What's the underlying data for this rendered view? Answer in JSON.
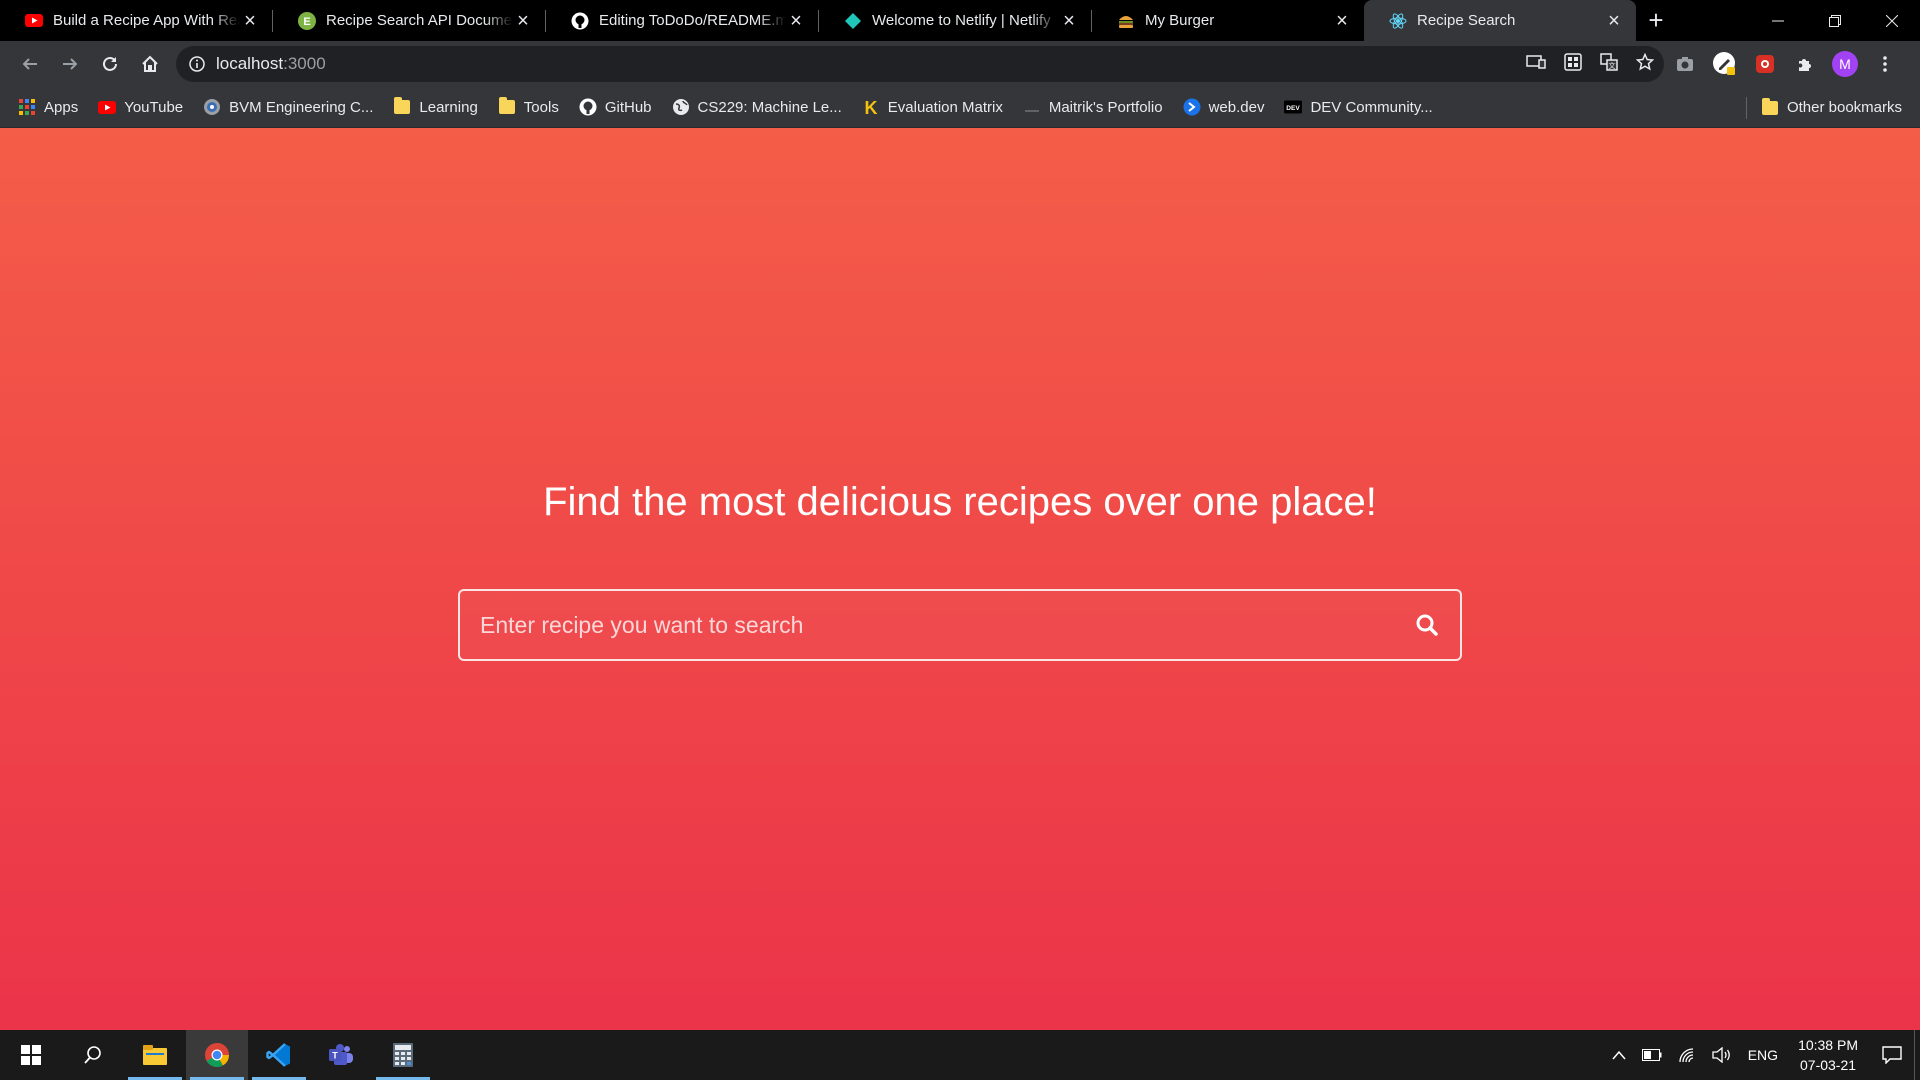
{
  "browser": {
    "tabs": [
      {
        "title": "Build a Recipe App With Reac",
        "favicon": "youtube-icon",
        "active": false
      },
      {
        "title": "Recipe Search API Document",
        "favicon": "edamam-icon",
        "active": false
      },
      {
        "title": "Editing ToDoDo/README.md",
        "favicon": "github-icon",
        "active": false
      },
      {
        "title": "Welcome to Netlify | Netlify",
        "favicon": "netlify-icon",
        "active": false
      },
      {
        "title": "My Burger",
        "favicon": "burger-icon",
        "active": false
      },
      {
        "title": "Recipe Search",
        "favicon": "react-icon",
        "active": true
      }
    ],
    "address": {
      "host": "localhost",
      "port": ":3000"
    },
    "profile_initial": "M",
    "bookmarks": [
      {
        "label": "Apps",
        "icon": "apps-grid-icon"
      },
      {
        "label": "YouTube",
        "icon": "youtube-icon"
      },
      {
        "label": "BVM Engineering C...",
        "icon": "college-icon"
      },
      {
        "label": "Learning",
        "icon": "folder-icon"
      },
      {
        "label": "Tools",
        "icon": "folder-icon"
      },
      {
        "label": "GitHub",
        "icon": "github-icon"
      },
      {
        "label": "CS229: Machine Le...",
        "icon": "globe-icon"
      },
      {
        "label": "Evaluation Matrix",
        "icon": "k-icon"
      },
      {
        "label": "Maitrik's Portfolio",
        "icon": "page-icon"
      },
      {
        "label": "web.dev",
        "icon": "webdev-icon"
      },
      {
        "label": "DEV Community...",
        "icon": "dev-icon"
      }
    ],
    "other_bookmarks": "Other bookmarks"
  },
  "app": {
    "heading": "Find the most delicious recipes over one place!",
    "search": {
      "placeholder": "Enter recipe you want to search",
      "value": ""
    },
    "gradient": {
      "top": "#f45d48",
      "bottom": "#eb3349"
    }
  },
  "taskbar": {
    "language": "ENG",
    "time": "10:38 PM",
    "date": "07-03-21"
  }
}
